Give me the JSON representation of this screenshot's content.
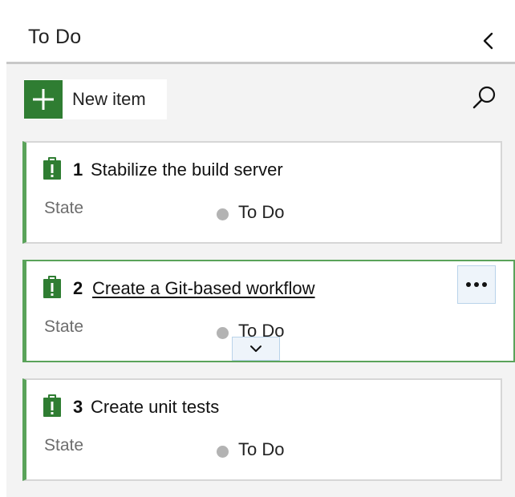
{
  "panel": {
    "title": "To Do",
    "collapse_icon": "chevron-left-icon"
  },
  "toolbar": {
    "new_item_label": "New item",
    "new_item_icon": "plus-icon",
    "search_icon": "search-icon"
  },
  "colors": {
    "accent_green": "#2f7d32",
    "card_stripe": "#5aa35a",
    "state_dot": "#b3b3b3"
  },
  "cards": [
    {
      "id": "1",
      "title": "Stabilize the build server",
      "field_label": "State",
      "state": "To Do",
      "icon": "task-clipboard-icon"
    },
    {
      "id": "2",
      "title": "Create a Git-based workflow",
      "field_label": "State",
      "state": "To Do",
      "icon": "task-clipboard-icon",
      "more_icon": "ellipsis-icon",
      "expand_icon": "chevron-down-icon"
    },
    {
      "id": "3",
      "title": "Create unit tests",
      "field_label": "State",
      "state": "To Do",
      "icon": "task-clipboard-icon"
    }
  ]
}
